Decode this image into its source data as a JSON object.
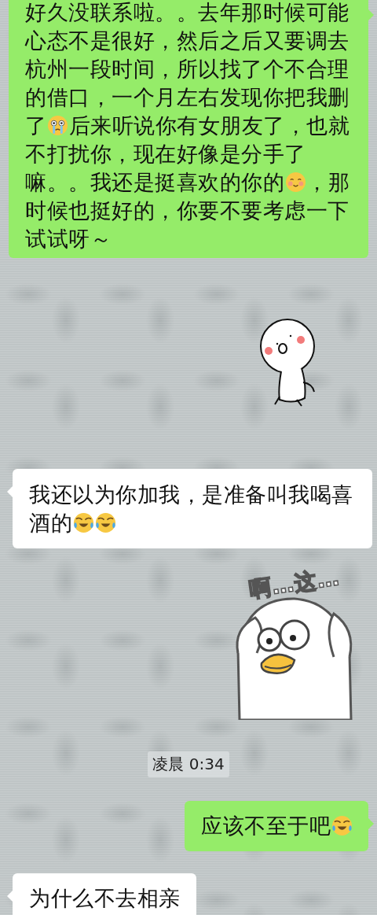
{
  "messages": [
    {
      "kind": "text",
      "sent": true,
      "parts": [
        {
          "kind": "text",
          "text": "好久没联系啦。。去年那时候可能心态不是很好，然后之后又要调去杭州一段时间，所以找了个不合理的借口，一个月左右发现你把我删了"
        },
        {
          "kind": "crying"
        },
        {
          "kind": "text",
          "text": "后来听说你有女朋友了，也就不打扰你，现在好像是分手了嘛。。我还是挺喜欢的你的"
        },
        {
          "kind": "blush"
        },
        {
          "kind": "text",
          "text": "，那时候也挺好的，你要不要考虑一下试试呀～"
        }
      ]
    },
    {
      "kind": "bun-sticker",
      "sent": true
    },
    {
      "kind": "text",
      "sent": false,
      "parts": [
        {
          "kind": "text",
          "text": "我还以为你加我，是准备叫我喝喜酒的"
        },
        {
          "kind": "laugh-cry"
        },
        {
          "kind": "laugh-cry"
        }
      ]
    },
    {
      "kind": "duck-sticker",
      "sent": true,
      "caption": "啊…这…"
    },
    {
      "kind": "time",
      "text": "凌晨 0:34"
    },
    {
      "kind": "text",
      "sent": true,
      "parts": [
        {
          "kind": "text",
          "text": "应该不至于吧"
        },
        {
          "kind": "laugh-cry"
        }
      ]
    },
    {
      "kind": "text",
      "sent": false,
      "parts": [
        {
          "kind": "text",
          "text": "为什么不去相亲"
        }
      ]
    }
  ]
}
